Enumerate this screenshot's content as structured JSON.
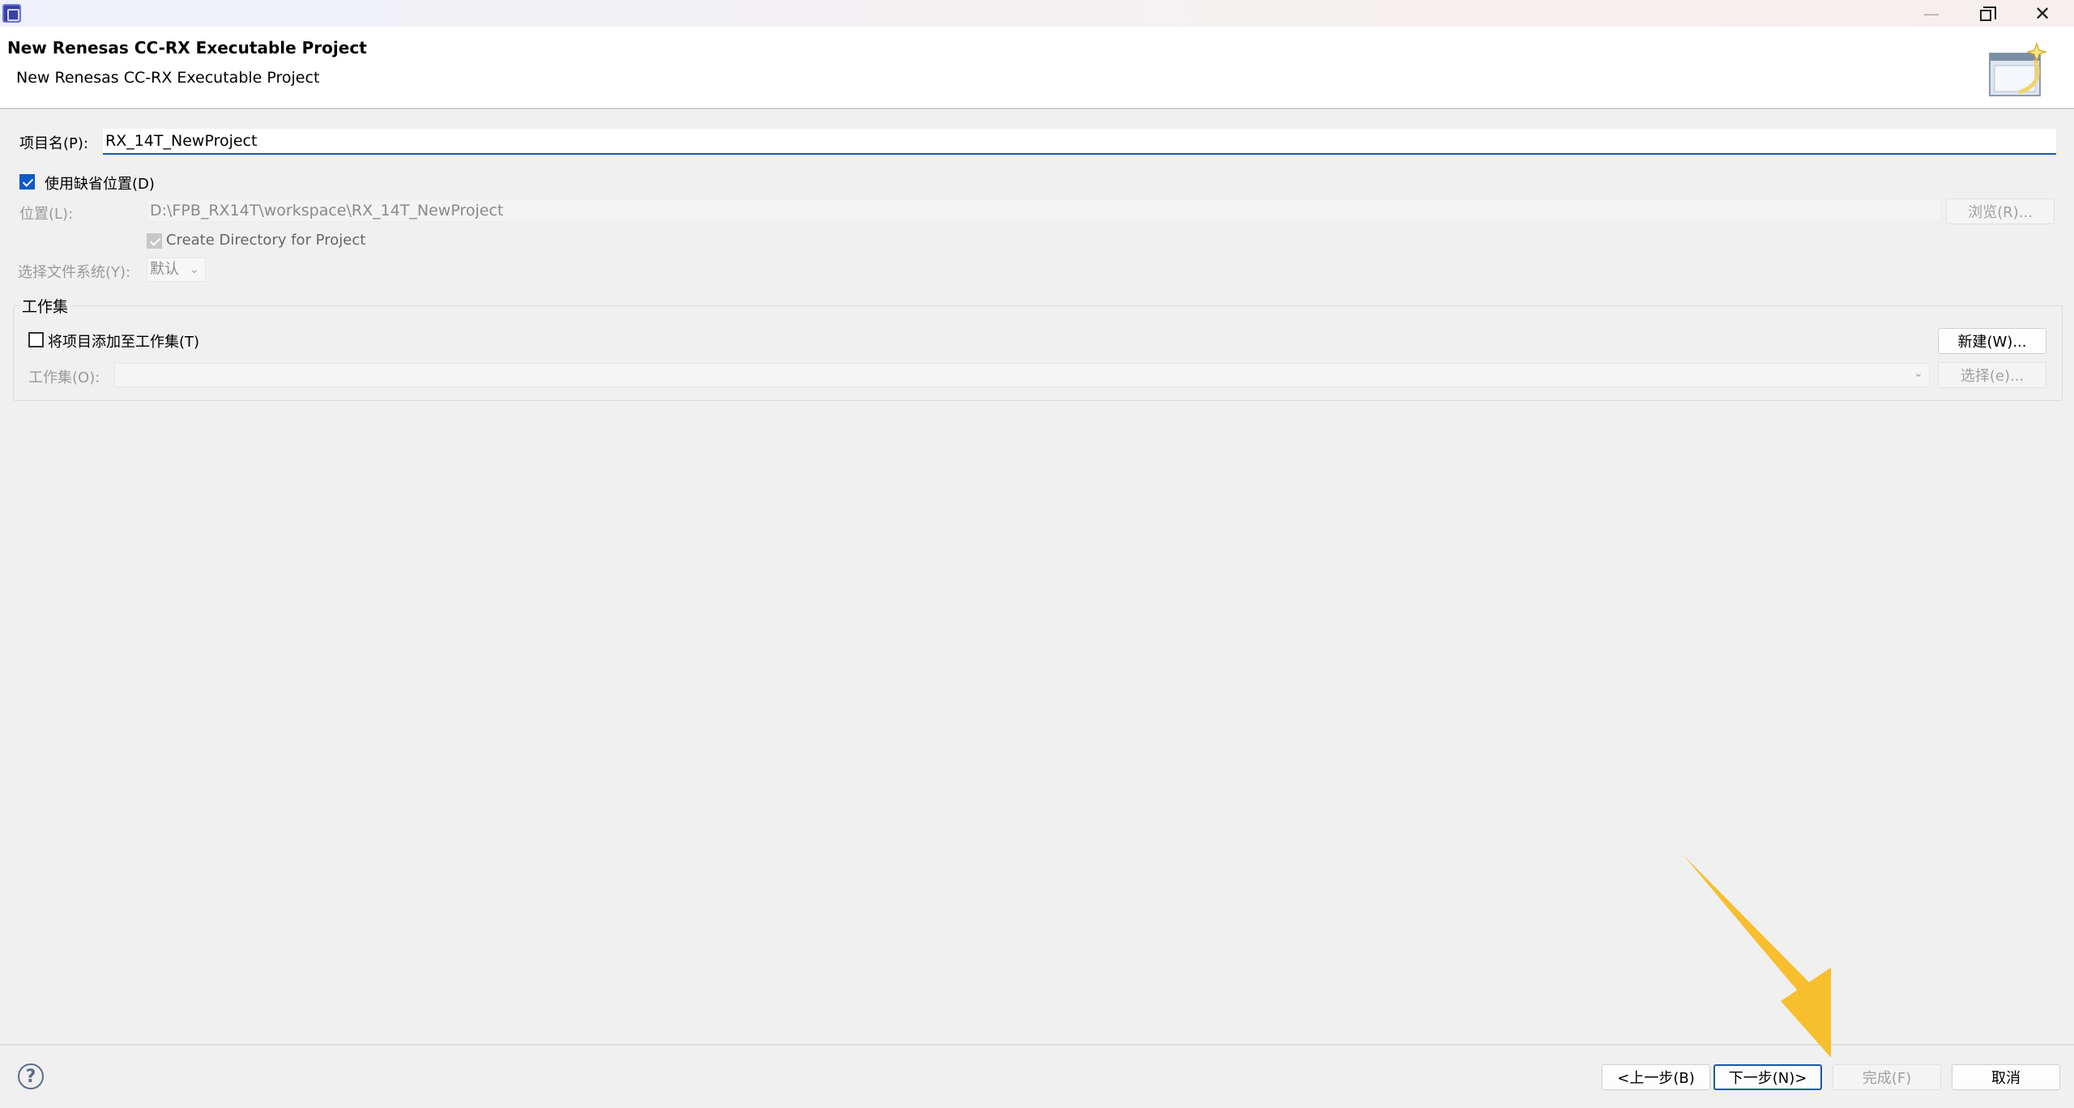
{
  "window": {
    "min_symbol": "—",
    "close_symbol": "✕"
  },
  "header": {
    "title": "New Renesas CC-RX Executable Project",
    "description": "New Renesas CC-RX Executable Project"
  },
  "form": {
    "project_name_label": "项目名(P):",
    "project_name_value": "RX_14T_NewProject",
    "use_default_location_label": "使用缺省位置(D)",
    "use_default_location_checked": true,
    "location_label": "位置(L):",
    "location_value": "D:\\FPB_RX14T\\workspace\\RX_14T_NewProject",
    "browse_button": "浏览(R)...",
    "create_directory_label": "Create Directory for Project",
    "create_directory_checked": true,
    "filesystem_label": "选择文件系统(Y):",
    "filesystem_value": "默认"
  },
  "working_sets": {
    "group_title": "工作集",
    "add_to_working_set_label": "将项目添加至工作集(T)",
    "add_to_working_set_checked": false,
    "new_button": "新建(W)...",
    "working_sets_label": "工作集(O):",
    "working_sets_value": "",
    "select_button": "选择(e)..."
  },
  "footer": {
    "help_symbol": "?",
    "back_button": "<上一步(B)",
    "next_button": "下一步(N)>",
    "finish_button": "完成(F)",
    "cancel_button": "取消"
  },
  "colors": {
    "accent": "#1a5aa8",
    "checkbox_checked": "#0a5ac8",
    "annotation_arrow": "#f7be2e"
  },
  "icons": {
    "app": "renesas-app-icon",
    "wizard": "new-project-wizard-icon",
    "help": "help-icon",
    "pointer": "yellow-arrow-annotation"
  }
}
